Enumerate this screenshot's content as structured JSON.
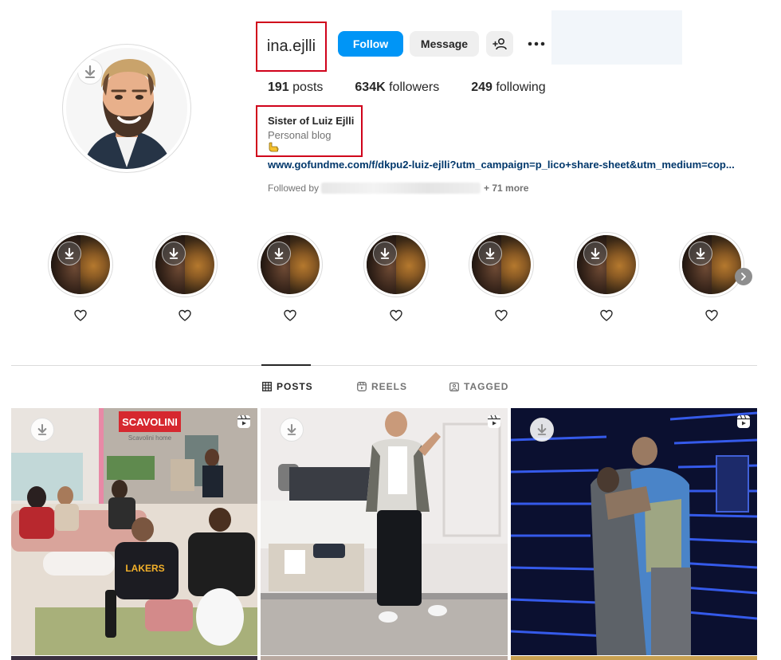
{
  "profile": {
    "username": "ina.ejlli",
    "buttons": {
      "follow": "Follow",
      "message": "Message",
      "add_user_icon": "add-person-icon",
      "more_icon": "more-horizontal-icon"
    },
    "stats": {
      "posts_count": "191",
      "posts_label": "posts",
      "followers_count": "634K",
      "followers_label": "followers",
      "following_count": "249",
      "following_label": "following"
    },
    "bio": {
      "name": "Sister of Luiz Ejlli",
      "category": "Personal blog",
      "emoji_icon": "pointing-hand-emoji",
      "link": "www.gofundme.com/f/dkpu2-luiz-ejlli?utm_campaign=p_lico+share-sheet&utm_medium=cop..."
    },
    "followed_by": {
      "prefix": "Followed by",
      "more": "+ 71 more"
    }
  },
  "highlights": [
    {
      "icon": "heart-icon"
    },
    {
      "icon": "heart-icon"
    },
    {
      "icon": "heart-icon"
    },
    {
      "icon": "heart-icon"
    },
    {
      "icon": "heart-icon"
    },
    {
      "icon": "heart-icon"
    },
    {
      "icon": "heart-icon"
    }
  ],
  "tabs": [
    {
      "label": "POSTS",
      "icon": "grid-icon",
      "active": true
    },
    {
      "label": "REELS",
      "icon": "reels-icon",
      "active": false
    },
    {
      "label": "TAGGED",
      "icon": "tagged-icon",
      "active": false
    }
  ],
  "posts": [
    {
      "type": "reel",
      "scene_text": "SCAVOLINI",
      "scene_subtext": "Scavolini home",
      "shirt_text": "LAKERS"
    },
    {
      "type": "reel"
    },
    {
      "type": "reel"
    }
  ],
  "colors": {
    "accent": "#0095f6",
    "highlight_box": "#d0021b",
    "link": "#00376b"
  }
}
